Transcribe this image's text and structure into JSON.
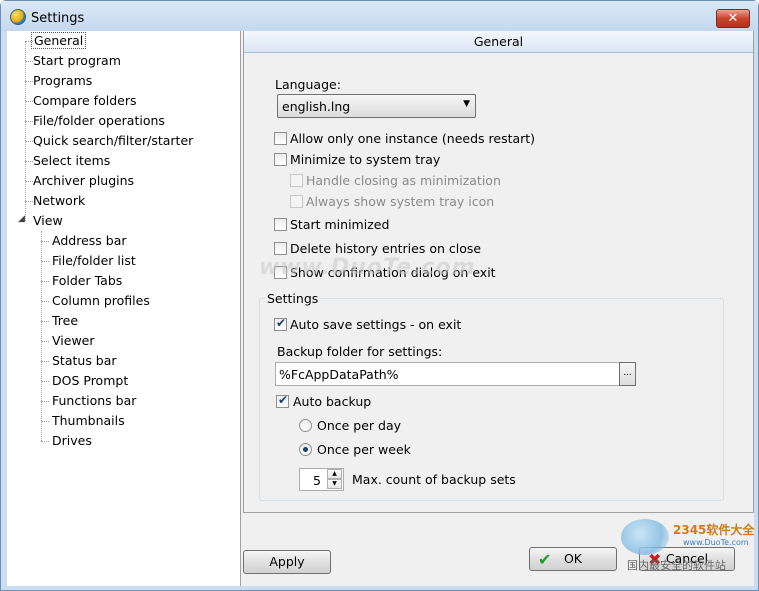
{
  "window": {
    "title": "Settings",
    "close_label": "✕"
  },
  "tree": {
    "items": [
      {
        "label": "General",
        "level": 0,
        "selected": true
      },
      {
        "label": "Start program",
        "level": 0
      },
      {
        "label": "Programs",
        "level": 0
      },
      {
        "label": "Compare folders",
        "level": 0
      },
      {
        "label": "File/folder operations",
        "level": 0
      },
      {
        "label": "Quick search/filter/starter",
        "level": 0
      },
      {
        "label": "Select items",
        "level": 0
      },
      {
        "label": "Archiver plugins",
        "level": 0
      },
      {
        "label": "Network",
        "level": 0
      },
      {
        "label": "View",
        "level": 0,
        "expanded": true
      },
      {
        "label": "Address bar",
        "level": 1
      },
      {
        "label": "File/folder list",
        "level": 1
      },
      {
        "label": "Folder Tabs",
        "level": 1
      },
      {
        "label": "Column profiles",
        "level": 1
      },
      {
        "label": "Tree",
        "level": 1
      },
      {
        "label": "Viewer",
        "level": 1
      },
      {
        "label": "Status bar",
        "level": 1
      },
      {
        "label": "DOS Prompt",
        "level": 1
      },
      {
        "label": "Functions bar",
        "level": 1
      },
      {
        "label": "Thumbnails",
        "level": 1
      },
      {
        "label": "Drives",
        "level": 1
      }
    ],
    "expander_glyph": "◢"
  },
  "panel": {
    "header": "General",
    "language_label": "Language:",
    "language_value": "english.lng",
    "dropdown_glyph": "▼",
    "options": {
      "one_instance": {
        "label": "Allow only one instance (needs restart)",
        "checked": false
      },
      "minimize_tray": {
        "label": "Minimize to system tray",
        "checked": false
      },
      "handle_closing": {
        "label": "Handle closing as minimization",
        "checked": false,
        "disabled": true
      },
      "always_tray_icon": {
        "label": "Always show system tray icon",
        "checked": false,
        "disabled": true
      },
      "start_minimized": {
        "label": "Start minimized",
        "checked": false
      },
      "delete_history": {
        "label": "Delete history entries on close",
        "checked": false
      },
      "confirm_exit": {
        "label": "Show confirmation dialog on exit",
        "checked": false
      }
    },
    "settings_group": {
      "title": "Settings",
      "auto_save": {
        "label": "Auto save settings - on exit",
        "checked": true
      },
      "backup_folder_label": "Backup folder for settings:",
      "backup_folder_value": "%FcAppDataPath%",
      "browse_label": "...",
      "auto_backup": {
        "label": "Auto backup",
        "checked": true
      },
      "once_per_day": {
        "label": "Once per day",
        "selected": false
      },
      "once_per_week": {
        "label": "Once per week",
        "selected": true
      },
      "max_count_value": "5",
      "max_count_label": "Max. count of backup sets",
      "spin_up": "▲",
      "spin_down": "▼"
    },
    "check_glyph": "✔"
  },
  "buttons": {
    "apply": "Apply",
    "ok": "OK",
    "cancel": "Cancel",
    "ok_icon_glyph": "✔",
    "cancel_icon_glyph": "✖"
  },
  "watermarks": {
    "duote": "www.DuoTe.com",
    "brand": "2345软件大全",
    "brand_url": "www.DuoTe.com",
    "brand_cn": "国内最安全的软件站"
  },
  "colors": {
    "ok_icon": "#1f9b2f",
    "cancel_icon": "#cc1a1a",
    "accent": "#1d3f72"
  }
}
